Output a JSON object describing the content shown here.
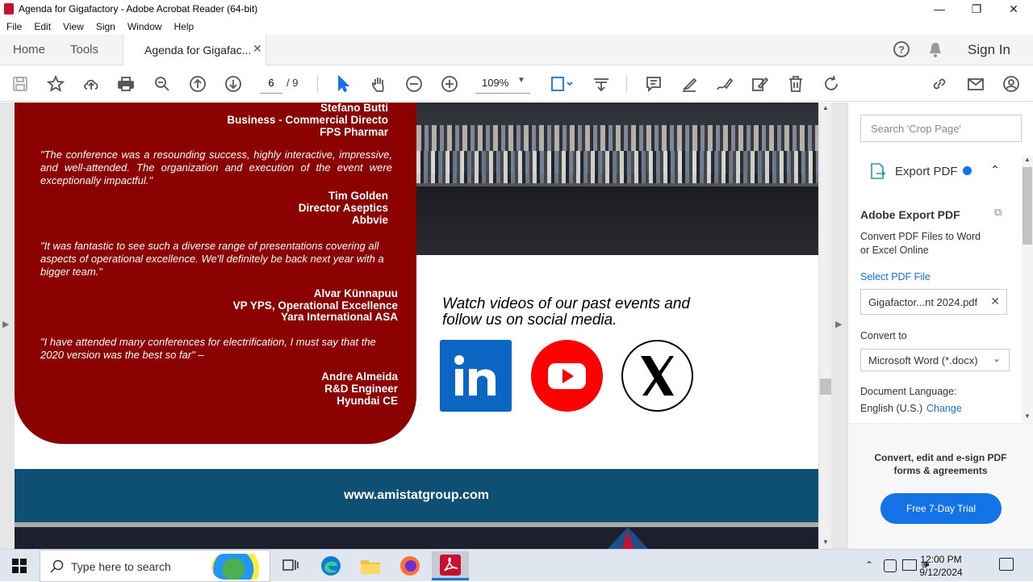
{
  "window": {
    "title": "Agenda for Gigafactory - Adobe Acrobat Reader (64-bit)"
  },
  "menu": [
    "File",
    "Edit",
    "View",
    "Sign",
    "Window",
    "Help"
  ],
  "tabs": {
    "home": "Home",
    "tools": "Tools",
    "document": "Agenda for Gigafac...",
    "sign_in": "Sign In"
  },
  "toolbar": {
    "page_current": "6",
    "page_total": "/ 9",
    "zoom": "109%"
  },
  "document": {
    "testimonials": [
      {
        "name": "Stefano Butti",
        "title": "Business - Commercial Directo",
        "company": "FPS Pharmar"
      },
      {
        "quote": "\"The conference was a resounding success, highly interactive, impressive, and well-attended. The organization and execution of the event were exceptionally impactful.\"",
        "name": "Tim Golden",
        "title": "Director Aseptics",
        "company": "Abbvie"
      },
      {
        "quote": "\"It was fantastic to see such a diverse range of presentations covering all aspects of operational excellence. We'll definitely be back next year with a bigger team.\"",
        "name": "Alvar Künnapuu",
        "title": "VP YPS, Operational Excellence",
        "company": "Yara International ASA"
      },
      {
        "quote": "\"I have attended many conferences for electrification, I must say that the 2020 version was the best so far\" –",
        "name": "Andre Almeida",
        "title": "R&D Engineer",
        "company": "Hyundai CE"
      }
    ],
    "watch_line1": "Watch videos of our past events and",
    "watch_line2": "follow us on social media.",
    "website": "www.amistatgroup.com"
  },
  "right_panel": {
    "search_placeholder": "Search 'Crop Page'",
    "export_title": "Export PDF",
    "adobe_export": "Adobe Export PDF",
    "convert_desc_1": "Convert PDF Files to Word",
    "convert_desc_2": "or Excel Online",
    "select_file": "Select PDF File",
    "file_name": "Gigafactor...nt 2024.pdf",
    "convert_to": "Convert to",
    "format": "Microsoft Word (*.docx)",
    "doc_language": "Document Language:",
    "language": "English (U.S.)",
    "change": "Change",
    "promo_line1": "Convert, edit and e-sign PDF",
    "promo_line2": "forms & agreements",
    "trial_button": "Free 7-Day Trial"
  },
  "taskbar": {
    "search_placeholder": "Type here to search",
    "time": "12:00 PM",
    "date": "9/12/2024"
  },
  "colors": {
    "accent_red": "#8b0000",
    "banner_blue": "#0e5073",
    "adobe_blue": "#1473e6"
  }
}
